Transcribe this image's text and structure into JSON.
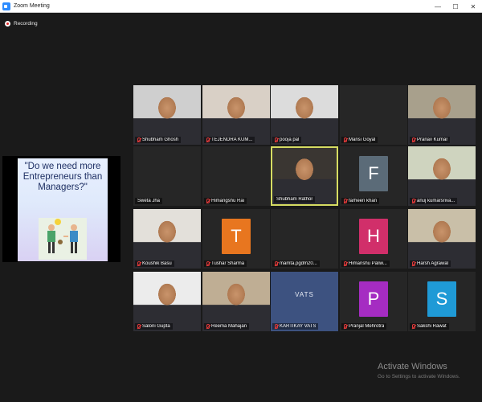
{
  "window": {
    "title": "Zoom Meeting",
    "minimize": "—",
    "maximize": "☐",
    "close": "✕"
  },
  "status": {
    "recording_label": "Recording"
  },
  "share": {
    "question": "\"Do we need more Entrepreneurs than Managers?\""
  },
  "participants": [
    {
      "name": "Shubham Ghosh",
      "muted": true,
      "video": true,
      "bg": "#cfcfcf"
    },
    {
      "name": "TEJENDRA KUM...",
      "muted": true,
      "video": true,
      "bg": "#d9d0c6"
    },
    {
      "name": "pooja pal",
      "muted": true,
      "video": true,
      "bg": "#dcdcdc"
    },
    {
      "name": "Mansi Goyal",
      "muted": true,
      "video": false,
      "bg": "#262626"
    },
    {
      "name": "Pranav Kumar",
      "muted": true,
      "video": true,
      "bg": "#a8a08c"
    },
    {
      "name": "Sweta Jha",
      "muted": false,
      "video": false,
      "bg": "#262626"
    },
    {
      "name": "Himangshu Rai",
      "muted": true,
      "video": false,
      "bg": "#262626"
    },
    {
      "name": "Shubham Rathor",
      "muted": false,
      "video": true,
      "bg": "#3a3632",
      "active": true
    },
    {
      "name": "farheen khan",
      "muted": true,
      "video": false,
      "bg": "#262626",
      "initial": "F",
      "initial_color": "#5b6b78"
    },
    {
      "name": "anuj kumarsriva...",
      "muted": true,
      "video": true,
      "bg": "#cfd4bf"
    },
    {
      "name": "Koushik Basu",
      "muted": true,
      "video": true,
      "bg": "#e3e0da"
    },
    {
      "name": "Tushar Sharma",
      "muted": true,
      "video": false,
      "bg": "#262626",
      "initial": "T",
      "initial_color": "#e8761f"
    },
    {
      "name": "mamta.pgdm20...",
      "muted": true,
      "video": false,
      "bg": "#262626"
    },
    {
      "name": "Himanshu Paliw...",
      "muted": true,
      "video": false,
      "bg": "#262626",
      "initial": "H",
      "initial_color": "#d12f6a"
    },
    {
      "name": "Harsh Agrawal",
      "muted": true,
      "video": true,
      "bg": "#c9bfa8"
    },
    {
      "name": "Saloni Gupta",
      "muted": true,
      "video": true,
      "bg": "#ececec"
    },
    {
      "name": "Reema Mahajan",
      "muted": true,
      "video": true,
      "bg": "#bfae94"
    },
    {
      "name": "KARTIKAY VATS",
      "muted": true,
      "video": true,
      "bg": "#3d5280",
      "logo": "VATS"
    },
    {
      "name": "Pranjal Mehrotra",
      "muted": true,
      "video": false,
      "bg": "#262626",
      "initial": "P",
      "initial_color": "#a52cc2"
    },
    {
      "name": "Sakshi Rawat",
      "muted": true,
      "video": false,
      "bg": "#262626",
      "initial": "S",
      "initial_color": "#1f9ad6"
    }
  ],
  "activation": {
    "title": "Activate Windows",
    "subtitle": "Go to Settings to activate Windows."
  }
}
